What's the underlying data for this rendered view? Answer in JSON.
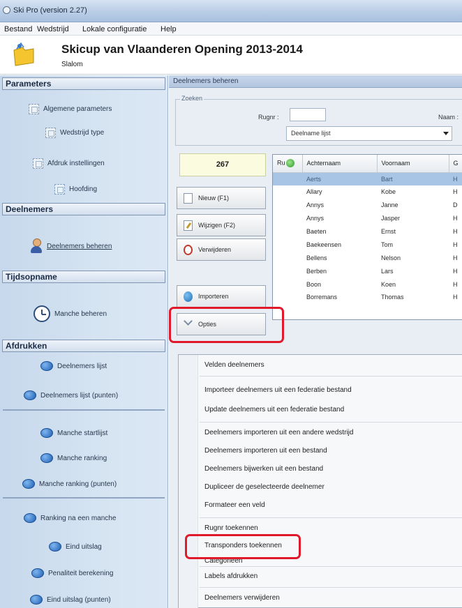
{
  "window": {
    "title": "Ski Pro (version 2.27)"
  },
  "menubar": [
    "Bestand",
    "Wedstrijd",
    "Lokale configuratie",
    "Help"
  ],
  "header": {
    "title": "Skicup van Vlaanderen Opening 2013-2014",
    "subtitle": "Slalom"
  },
  "sidebar": {
    "parameters": {
      "title": "Parameters",
      "items": [
        "Algemene parameters",
        "Wedstrijd type",
        "Afdruk instellingen",
        "Hoofding"
      ]
    },
    "deelnemers": {
      "title": "Deelnemers",
      "items": [
        "Deelnemers beheren"
      ]
    },
    "tijdsopname": {
      "title": "Tijdsopname",
      "items": [
        "Manche beheren"
      ]
    },
    "afdrukken": {
      "title": "Afdrukken",
      "items": [
        "Deelnemers lijst",
        "Deelnemers lijst (punten)",
        "Manche startlijst",
        "Manche ranking",
        "Manche ranking (punten)",
        "Ranking na een manche",
        "Eind uitslag",
        "Penaliteit berekening",
        "Eind uitslag (punten)"
      ]
    }
  },
  "panel": {
    "title": "Deelnemers beheren",
    "search": {
      "legend": "Zoeken",
      "rugnr_label": "Rugnr :",
      "naam_label": "Naam :",
      "list_select": "Deelname lijst"
    },
    "count": "267",
    "buttons": {
      "nieuw": "Nieuw (F1)",
      "wijzigen": "Wijzigen (F2)",
      "verwijderen": "Verwijderen",
      "importeren": "Importeren",
      "opties": "Opties"
    },
    "grid": {
      "columns": [
        "Ru",
        "Achternaam",
        "Voornaam",
        "G"
      ],
      "rows": [
        [
          "",
          "Aerts",
          "Bart",
          "H"
        ],
        [
          "",
          "Allary",
          "Kobe",
          "H"
        ],
        [
          "",
          "Annys",
          "Janne",
          "D"
        ],
        [
          "",
          "Annys",
          "Jasper",
          "H"
        ],
        [
          "",
          "Baeten",
          "Ernst",
          "H"
        ],
        [
          "",
          "Baekeensen",
          "Tom",
          "H"
        ],
        [
          "",
          "Bellens",
          "Nelson",
          "H"
        ],
        [
          "",
          "Berben",
          "Lars",
          "H"
        ],
        [
          "",
          "Boon",
          "Koen",
          "H"
        ],
        [
          "",
          "Borremans",
          "Thomas",
          "H"
        ]
      ]
    }
  },
  "options_menu": {
    "items": [
      "Velden deelnemers",
      "Importeer deelnemers uit een federatie bestand",
      "Update deelnemers uit een federatie bestand",
      "Deelnemers importeren uit een andere wedstrijd",
      "Deelnemers importeren uit een bestand",
      "Deelnemers bijwerken uit een bestand",
      "Dupliceer de geselecteerde deelnemer",
      "Formateer een veld",
      "Rugnr toekennen",
      "Transponders toekennen",
      "Categorieën",
      "Labels afdrukken",
      "Deelnemers verwijderen"
    ]
  },
  "colors": {
    "highlight": "#e01a2b",
    "selection": "#a9c5e6",
    "sidebar": "#d6e4f2"
  }
}
